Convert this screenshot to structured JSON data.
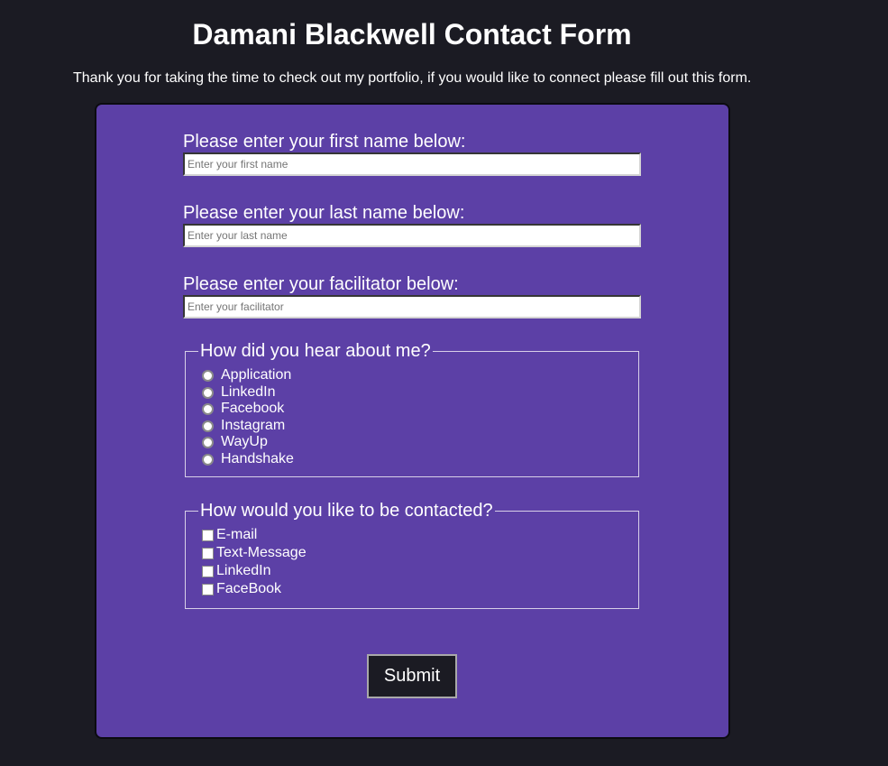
{
  "title": "Damani Blackwell Contact Form",
  "intro": "Thank you for taking the time to check out my portfolio, if you would like to connect please fill out this form.",
  "fields": [
    {
      "label": "Please enter your first name below:",
      "placeholder": "Enter your first name",
      "value": ""
    },
    {
      "label": "Please enter your last name below:",
      "placeholder": "Enter your last name",
      "value": ""
    },
    {
      "label": "Please enter your facilitator below:",
      "placeholder": "Enter your facilitator",
      "value": ""
    }
  ],
  "hear": {
    "legend": "How did you hear about me?",
    "options": [
      "Application",
      "LinkedIn",
      "Facebook",
      "Instagram",
      "WayUp",
      "Handshake"
    ]
  },
  "contact": {
    "legend": "How would you like to be contacted?",
    "options": [
      "E-mail",
      "Text-Message",
      "LinkedIn",
      "FaceBook"
    ]
  },
  "submit_label": "Submit"
}
